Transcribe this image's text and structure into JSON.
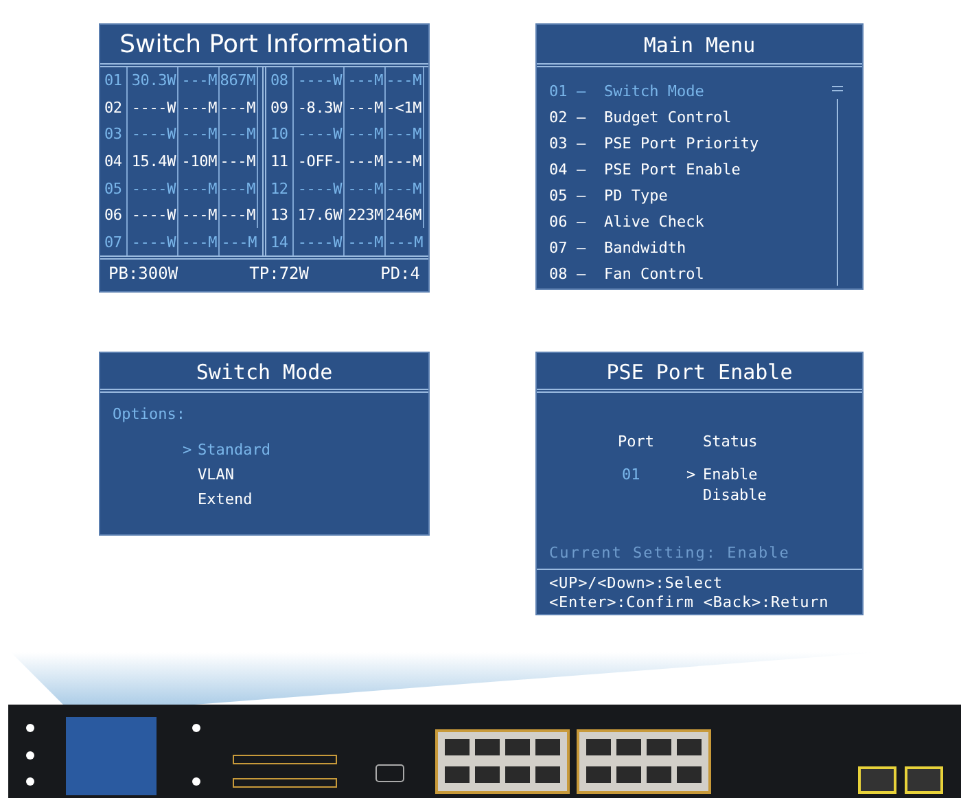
{
  "port_info": {
    "title": "Switch Port Information",
    "rows": [
      {
        "port": "01",
        "power": "30.3W",
        "column_3": "---M",
        "column_4": "867M"
      },
      {
        "port": "02",
        "power": "----W",
        "column_3": "---M",
        "column_4": "---M"
      },
      {
        "port": "03",
        "power": "----W",
        "column_3": "---M",
        "column_4": "---M"
      },
      {
        "port": "04",
        "power": "15.4W",
        "column_3": "-10M",
        "column_4": "---M"
      },
      {
        "port": "05",
        "power": "----W",
        "column_3": "---M",
        "column_4": "---M"
      },
      {
        "port": "06",
        "power": "----W",
        "column_3": "---M",
        "column_4": "---M"
      },
      {
        "port": "07",
        "power": "----W",
        "column_3": "---M",
        "column_4": "---M"
      },
      {
        "port": "08",
        "power": "----W",
        "column_3": "---M",
        "column_4": "---M"
      },
      {
        "port": "09",
        "power": "-8.3W",
        "column_3": "---M",
        "column_4": "-<1M"
      },
      {
        "port": "10",
        "power": "----W",
        "column_3": "---M",
        "column_4": "---M"
      },
      {
        "port": "11",
        "power": "-OFF-",
        "column_3": "---M",
        "column_4": "---M"
      },
      {
        "port": "12",
        "power": "----W",
        "column_3": "---M",
        "column_4": "---M"
      },
      {
        "port": "13",
        "power": "17.6W",
        "column_3": "223M",
        "column_4": "246M"
      },
      {
        "port": "14",
        "power": "----W",
        "column_3": "---M",
        "column_4": "---M"
      }
    ],
    "footer": [
      "PB:300W",
      "TP:72W",
      "PD:4"
    ]
  },
  "main_menu": {
    "title": "Main Menu",
    "items": [
      {
        "number": "01",
        "separator": "—",
        "label": "Switch Mode",
        "selected": true
      },
      {
        "number": "02",
        "separator": "—",
        "label": "Budget Control",
        "selected": false
      },
      {
        "number": "03",
        "separator": "—",
        "label": "PSE Port Priority",
        "selected": false
      },
      {
        "number": "04",
        "separator": "—",
        "label": "PSE Port Enable",
        "selected": false
      },
      {
        "number": "05",
        "separator": "—",
        "label": "PD Type",
        "selected": false
      },
      {
        "number": "06",
        "separator": "—",
        "label": "Alive Check",
        "selected": false
      },
      {
        "number": "07",
        "separator": "—",
        "label": "Bandwidth",
        "selected": false
      },
      {
        "number": "08",
        "separator": "—",
        "label": "Fan Control",
        "selected": false
      }
    ]
  },
  "switch_mode": {
    "title": "Switch Mode",
    "options_label": "Options:",
    "cursor": ">",
    "options": [
      {
        "label": "Standard",
        "selected": true
      },
      {
        "label": "VLAN",
        "selected": false
      },
      {
        "label": "Extend",
        "selected": false
      }
    ]
  },
  "pse_port_enable": {
    "title": "PSE Port Enable",
    "port_header": "Port",
    "status_header": "Status",
    "port": "01",
    "cursor": ">",
    "options": [
      {
        "label": "Enable",
        "selected": true
      },
      {
        "label": "Disable",
        "selected": false
      }
    ],
    "current_setting": "Current Setting: Enable",
    "help": [
      "<UP>/<Down>:Select",
      "<Enter>:Confirm <Back>:Return"
    ]
  }
}
